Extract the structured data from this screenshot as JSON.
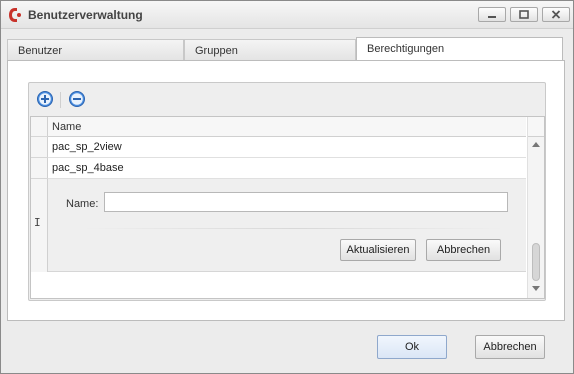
{
  "window": {
    "title": "Benutzerverwaltung"
  },
  "tabs": [
    {
      "label": "Benutzer",
      "active": false
    },
    {
      "label": "Gruppen",
      "active": false
    },
    {
      "label": "Berechtigungen",
      "active": true
    }
  ],
  "toolbar": {
    "add_icon": "plus-circle-icon",
    "remove_icon": "minus-circle-icon"
  },
  "grid": {
    "columns": [
      "Name"
    ],
    "rows": [
      {
        "name": "pac_sp_2view"
      },
      {
        "name": "pac_sp_4base"
      }
    ]
  },
  "edit_form": {
    "name_label": "Name:",
    "name_value": "",
    "update_label": "Aktualisieren",
    "cancel_label": "Abbrechen",
    "cursor_glyph": "I"
  },
  "footer": {
    "ok_label": "Ok",
    "cancel_label": "Abbrechen"
  },
  "colors": {
    "accent": "#3a7bd5",
    "brand_icon": "#c8322a"
  }
}
